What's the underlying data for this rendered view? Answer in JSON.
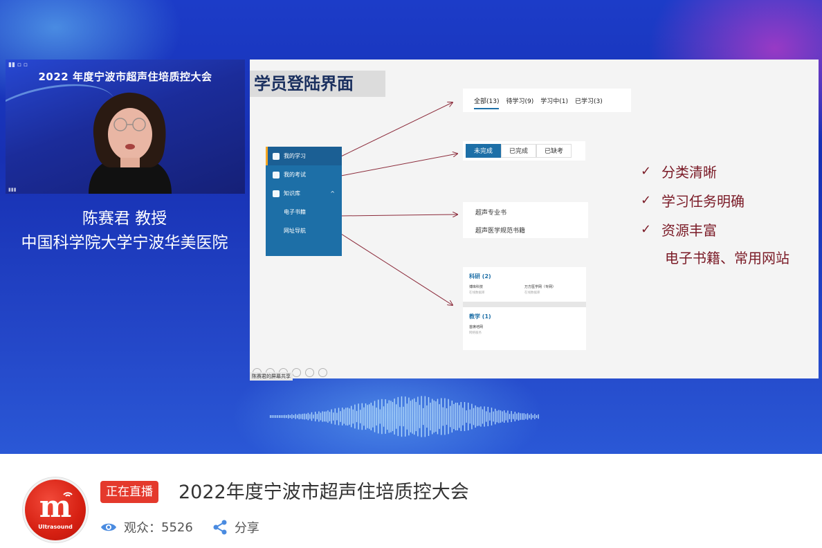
{
  "speaker_tile": {
    "banner": "2022 年度宁波市超声住培质控大会"
  },
  "presenter": {
    "name": "陈赛君 教授",
    "institution": "中国科学院大学宁波华美医院"
  },
  "slide": {
    "title": "学员登陆界面",
    "menu": [
      "我的学习",
      "我的考试",
      "知识库",
      "电子书籍",
      "网址导航"
    ],
    "tabs": [
      "全部(13)",
      "待学习(9)",
      "学习中(1)",
      "已学习(3)"
    ],
    "segments": [
      "未完成",
      "已完成",
      "已缺考"
    ],
    "books": [
      "超声专业书",
      "超声医学规范书籍"
    ],
    "sites": {
      "cat1": "科研 (2)",
      "cat1_items": [
        "博库科技",
        "万方医学网（专网）"
      ],
      "cat1_sub": [
        "在线数据库",
        "在线数据库"
      ],
      "cat2": "教学 (1)",
      "cat2_item": "首席培网",
      "cat2_sub": "网络服务"
    },
    "points": [
      "分类清晰",
      "学习任务明确",
      "资源丰富"
    ],
    "points_extra": "电子书籍、常用网站",
    "share_label": "陈赛君的屏幕共享"
  },
  "info": {
    "logo_text": "Ultrasound",
    "live_badge": "正在直播",
    "title": "2022年度宁波市超声住培质控大会",
    "views_label": "观众：",
    "views_count": "5526",
    "share_label": "分享"
  },
  "colors": {
    "live_red": "#e4392c",
    "accent_blue": "#1d6fa7",
    "slide_text": "#7a1a26"
  }
}
